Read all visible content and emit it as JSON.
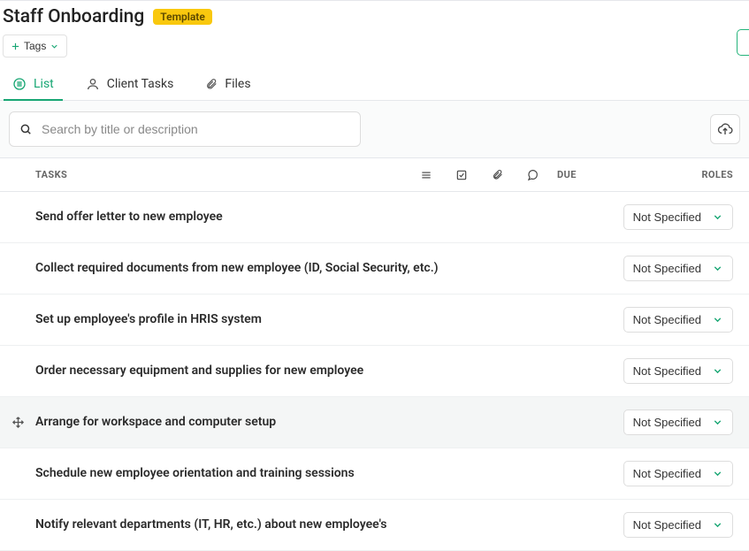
{
  "header": {
    "title": "Staff Onboarding",
    "badge": "Template",
    "tags_label": "Tags"
  },
  "tabs": {
    "list": "List",
    "client_tasks": "Client Tasks",
    "files": "Files"
  },
  "search": {
    "placeholder": "Search by title or description"
  },
  "columns": {
    "tasks": "TASKS",
    "due": "DUE",
    "roles": "ROLES"
  },
  "role_default": "Not Specified",
  "tasks": [
    {
      "title": "Send offer letter to new employee"
    },
    {
      "title": "Collect required documents from new employee (ID, Social Security, etc.)"
    },
    {
      "title": "Set up employee's profile in HRIS system"
    },
    {
      "title": "Order necessary equipment and supplies for new employee"
    },
    {
      "title": "Arrange for workspace and computer setup",
      "hover": true
    },
    {
      "title": "Schedule new employee orientation and training sessions"
    },
    {
      "title": "Notify relevant departments (IT, HR, etc.) about new employee's"
    }
  ]
}
